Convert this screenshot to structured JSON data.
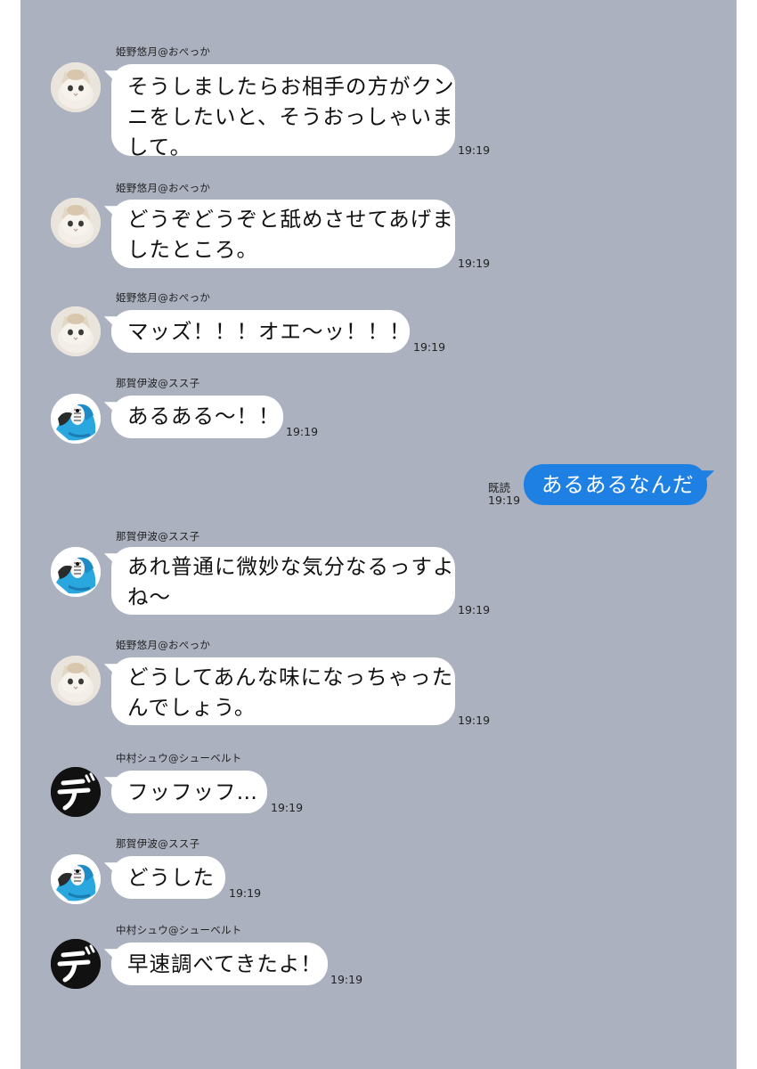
{
  "colors": {
    "chat_background": "#abb1bf",
    "incoming_bubble": "#ffffff",
    "outgoing_bubble": "#1f80e4"
  },
  "messages": [
    {
      "avatar": "cat-avatar-icon",
      "sender": "姫野悠月@おぺっか",
      "lines": [
        "そうしましたらお相手の方がクン",
        "ニをしたいと、そうおっしゃいま",
        "して。"
      ],
      "time": "19:19"
    },
    {
      "avatar": "cat-avatar-icon",
      "sender": "姫野悠月@おぺっか",
      "lines": [
        "どうぞどうぞと舐めさせてあげま",
        "したところ。"
      ],
      "time": "19:19"
    },
    {
      "avatar": "cat-avatar-icon",
      "sender": "姫野悠月@おぺっか",
      "lines": [
        "マッズ！！！オエ〜ッ！！！"
      ],
      "time": "19:19"
    },
    {
      "avatar": "parrot-avatar-icon",
      "sender": "那賀伊波@スス子",
      "lines": [
        "あるある〜！！"
      ],
      "time": "19:19"
    },
    {
      "outgoing": true,
      "read_label": "既読",
      "time": "19:19",
      "text": "あるあるなんだ"
    },
    {
      "avatar": "parrot-avatar-icon",
      "sender": "那賀伊波@スス子",
      "lines": [
        "あれ普通に微妙な気分なるっすよ",
        "ね〜"
      ],
      "time": "19:19"
    },
    {
      "avatar": "cat-avatar-icon",
      "sender": "姫野悠月@おぺっか",
      "lines": [
        "どうしてあんな味になっちゃった",
        "んでしょう。"
      ],
      "time": "19:19"
    },
    {
      "avatar": "de-avatar-icon",
      "sender": "中村シュウ@シューベルト",
      "lines": [
        "フッフッフ…"
      ],
      "time": "19:19"
    },
    {
      "avatar": "parrot-avatar-icon",
      "sender": "那賀伊波@スス子",
      "lines": [
        "どうした"
      ],
      "time": "19:19"
    },
    {
      "avatar": "de-avatar-icon",
      "sender": "中村シュウ@シューベルト",
      "lines": [
        "早速調べてきたよ！"
      ],
      "time": "19:19"
    }
  ]
}
